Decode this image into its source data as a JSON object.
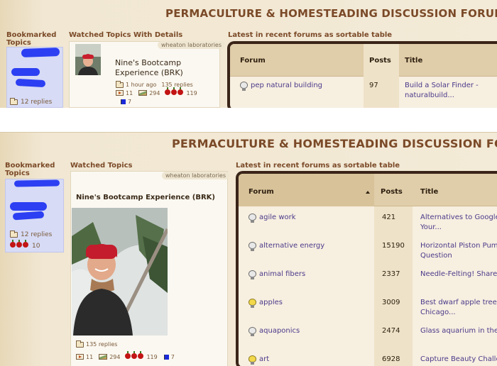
{
  "site_title": "PERMACULTURE & HOMESTEADING DISCUSSION FORUMS",
  "columns": {
    "bookmarked": "Bookmarked Topics",
    "watched_top": "Watched Topics With Details",
    "watched_bottom": "Watched Topics",
    "latest": "Latest in recent forums as sortable table"
  },
  "bookmarks": {
    "replies": "12 replies",
    "apple_count": "10"
  },
  "watched_topic": {
    "title": "Nine's Bootcamp Experience (BRK)",
    "tag": "wheaton laboratories",
    "time_ago": "1 hour ago",
    "replies": "135 replies",
    "video_count": "11",
    "image_count": "294",
    "apples": "119",
    "flags": "7"
  },
  "table": {
    "headers": {
      "forum": "Forum",
      "posts": "Posts",
      "title": "Title"
    },
    "top_rows": [
      {
        "forum": "pep natural building",
        "posts": "97",
        "topic_line1": "Build a Solar Finder -",
        "topic_line2": "naturalbuild...",
        "lit": false
      }
    ],
    "rows": [
      {
        "forum": "agile work",
        "posts": "421",
        "topic_line1": "Alternatives to Google",
        "topic_line2": "Your...",
        "lit": false
      },
      {
        "forum": "alternative energy",
        "posts": "15190",
        "topic_line1": "Horizontal Piston Pum",
        "topic_line2": "Question",
        "lit": false
      },
      {
        "forum": "animal fibers",
        "posts": "2337",
        "topic_line1": "Needle-Felting! Share",
        "topic_line2": "",
        "lit": false
      },
      {
        "forum": "apples",
        "posts": "3009",
        "topic_line1": "Best dwarf apple trees",
        "topic_line2": "Chicago...",
        "lit": true
      },
      {
        "forum": "aquaponics",
        "posts": "2474",
        "topic_line1": "Glass aquarium in the",
        "topic_line2": "",
        "lit": false
      },
      {
        "forum": "art",
        "posts": "6928",
        "topic_line1": "Capture Beauty Challe",
        "topic_line2": "",
        "lit": true
      }
    ]
  },
  "colors": {
    "title_brown": "#7b4a28",
    "link_purple": "#4a3a8a",
    "apple_red": "#c21414",
    "scribble_blue": "#2c3ff2"
  }
}
